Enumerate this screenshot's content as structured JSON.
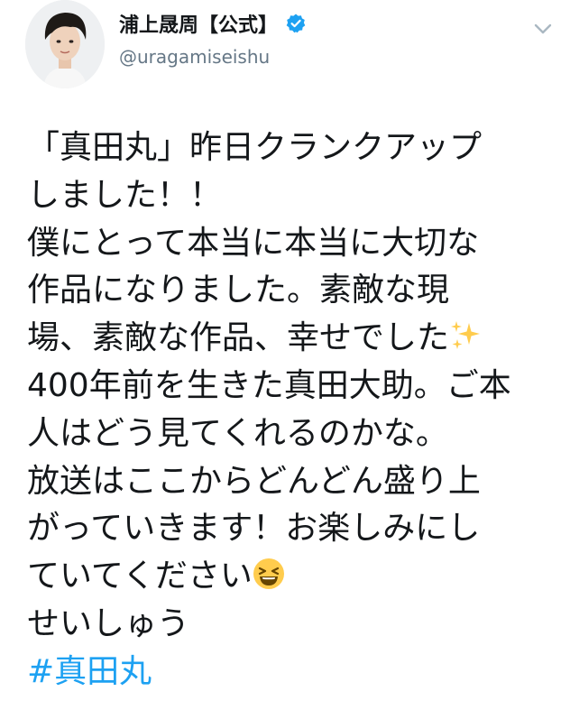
{
  "header": {
    "display_name": "浦上晟周【公式】",
    "handle": "@uragamiseishu",
    "verified_icon": "verified-badge-icon",
    "menu_icon": "chevron-down-icon",
    "colors": {
      "verified": "#1da1f2",
      "handle": "#657786",
      "chevron": "#aab8c2"
    }
  },
  "tweet": {
    "lines": [
      "「真田丸」昨日クランクアップ",
      "しました！！",
      "僕にとって本当に本当に大切な",
      "作品になりました。素敵な現",
      "場、素敵な作品、幸せでした",
      "400年前を生きた真田大助。ご本",
      "人はどう見てくれるのかな。",
      "放送はここからどんどん盛り上",
      "がっていきます！お楽しみにし",
      "ていてください",
      "せいしゅう"
    ],
    "hashtag": "#真田丸",
    "emojis": {
      "sparkles": "sparkles-emoji",
      "laughing": "laughing-face-emoji"
    },
    "colors": {
      "text": "#14171a",
      "hashtag": "#1da1f2"
    }
  }
}
